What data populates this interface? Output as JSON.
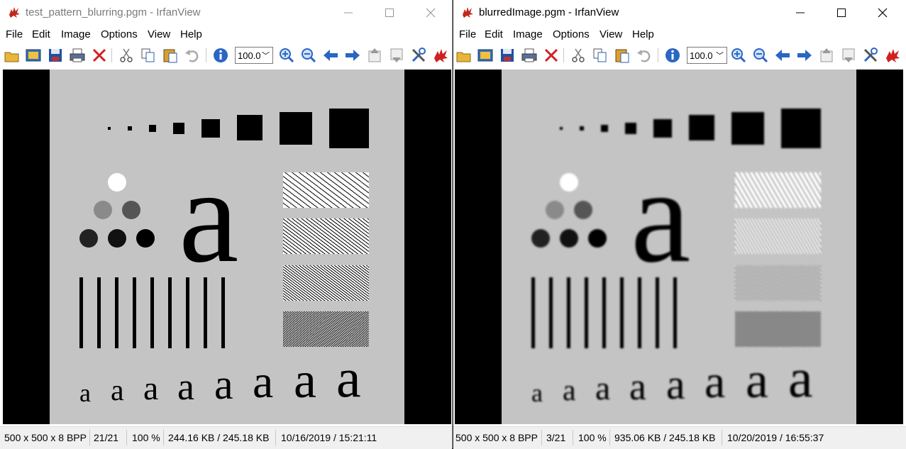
{
  "windows": [
    {
      "title": "test_pattern_blurring.pgm - IrfanView",
      "active": false,
      "status": [
        "500 x 500 x 8 BPP",
        "21/21",
        "100 %",
        "244.16 KB / 245.18 KB",
        "10/16/2019 / 15:21:11"
      ]
    },
    {
      "title": "blurredImage.pgm - IrfanView",
      "active": true,
      "status": [
        "500 x 500 x 8 BPP",
        "3/21",
        "100 %",
        "935.06 KB / 245.18 KB",
        "10/20/2019 / 16:55:37"
      ]
    }
  ],
  "menu": [
    "File",
    "Edit",
    "Image",
    "Options",
    "View",
    "Help"
  ],
  "zoom_value": "100.0",
  "toolbar_icons": [
    "open-icon",
    "thumbnails-icon",
    "save-icon",
    "print-icon",
    "delete-icon",
    "cut-icon",
    "copy-icon",
    "paste-icon",
    "undo-icon",
    "info-icon",
    "zoom-in-icon",
    "zoom-out-icon",
    "previous-icon",
    "next-icon",
    "page-up-icon",
    "page-down-icon",
    "settings-icon",
    "exit-icon"
  ],
  "image_text": {
    "big_letter": "a",
    "small_letter": "a"
  },
  "colors": {
    "background_gray": "#c4c4c4",
    "black": "#000000",
    "window_bg": "#ffffff"
  }
}
